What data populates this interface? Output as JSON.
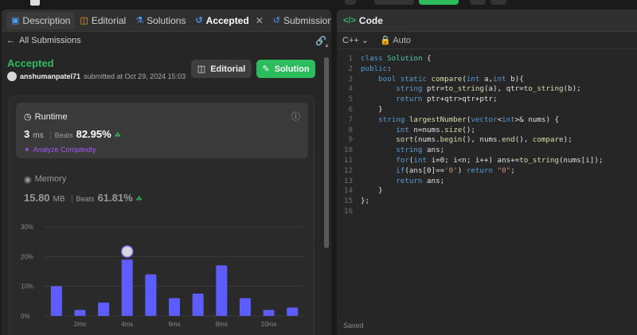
{
  "left_tabs": [
    {
      "label": "Description",
      "icon": "description-icon"
    },
    {
      "label": "Editorial",
      "icon": "book-icon"
    },
    {
      "label": "Solutions",
      "icon": "flask-icon"
    },
    {
      "label": "Accepted",
      "icon": "history-icon"
    },
    {
      "label": "Submissions",
      "icon": "history-icon"
    }
  ],
  "subhead": {
    "back_label": "All Submissions"
  },
  "result": {
    "status": "Accepted",
    "username": "anshumanpatel71",
    "submitted_text": "submitted at Oct 29, 2024 15:03",
    "editorial_btn": "Editorial",
    "solution_btn": "Solution"
  },
  "runtime": {
    "title": "Runtime",
    "value": "3",
    "unit": "ms",
    "beats_label": "Beats",
    "beats": "82.95%",
    "analyze": "Analyze Complexity"
  },
  "memory": {
    "title": "Memory",
    "value": "15.80",
    "unit": "MB",
    "beats_label": "Beats",
    "beats": "61.81%"
  },
  "chart_data": {
    "type": "bar",
    "categories": [
      "1ms",
      "2ms",
      "3ms",
      "4ms",
      "5ms",
      "6ms",
      "7ms",
      "8ms",
      "9ms",
      "10ms",
      "11ms"
    ],
    "x_tick_labels": [
      "2ms",
      "4ms",
      "6ms",
      "8ms",
      "10ms"
    ],
    "values": [
      10,
      2,
      4.5,
      19,
      14,
      6,
      7.5,
      17,
      6,
      2,
      2.8
    ],
    "ylim": [
      0,
      30
    ],
    "y_tick_labels": [
      "0%",
      "10%",
      "20%",
      "30%"
    ],
    "highlight_index": 3,
    "bar_color": "#5d5dff",
    "grid": true
  },
  "code_panel": {
    "tab_label": "Code",
    "language": "C++",
    "autocomplete": "Auto",
    "saved_label": "Saved"
  },
  "code_lines": [
    "class Solution {",
    "public:",
    "    bool static compare(int a,int b){",
    "        string ptr=to_string(a), qtr=to_string(b);",
    "        return ptr+qtr>qtr+ptr;",
    "    }",
    "    string largestNumber(vector<int>& nums) {",
    "        int n=nums.size();",
    "        sort(nums.begin(), nums.end(), compare);",
    "        string ans;",
    "        for(int i=0; i<n; i++) ans+=to_string(nums[i]);",
    "        if(ans[0]=='0') return \"0\";",
    "        return ans;",
    "    }",
    "};",
    ""
  ]
}
